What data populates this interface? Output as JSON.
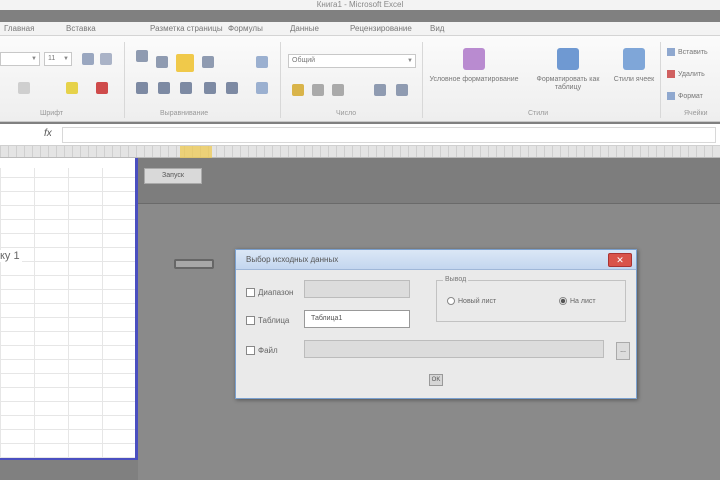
{
  "window": {
    "title": "Книга1 - Microsoft Excel"
  },
  "tabs": [
    {
      "label": "Главная"
    },
    {
      "label": "Вставка"
    },
    {
      "label": "Разметка страницы"
    },
    {
      "label": "Формулы"
    },
    {
      "label": "Данные"
    },
    {
      "label": "Рецензирование"
    },
    {
      "label": "Вид"
    }
  ],
  "ribbon": {
    "font_size_value": "11",
    "number_format_value": "Общий",
    "group_labels": {
      "font": "Шрифт",
      "alignment": "Выравнивание",
      "number": "Число",
      "styles": "Стили",
      "cells": "Ячейки"
    },
    "styles_buttons": [
      {
        "label": "Условное форматирование"
      },
      {
        "label": "Форматировать как таблицу"
      },
      {
        "label": "Стили ячеек"
      }
    ],
    "cells_items": [
      {
        "label": "Вставить"
      },
      {
        "label": "Удалить"
      },
      {
        "label": "Формат"
      }
    ]
  },
  "formula_bar": {
    "fx": "fx",
    "value": ""
  },
  "sheet": {
    "caption": "ку 1"
  },
  "editor": {
    "button_label": "Запуск"
  },
  "dialog": {
    "title": "Выбор исходных данных",
    "close_label": "✕",
    "options": [
      {
        "label": "Диапазон"
      },
      {
        "label": "Таблица"
      },
      {
        "label": "Файл"
      }
    ],
    "table_field_value": "Таблица1",
    "groupbox_label": "Вывод",
    "radios": [
      {
        "label": "Новый лист",
        "checked": false
      },
      {
        "label": "На лист",
        "checked": true
      }
    ],
    "browse_label": "...",
    "ok_label": "OK"
  },
  "colors": {
    "accent_border": "#4a4fc0",
    "dialog_title": "#c3d6ef",
    "close_button": "#d9534a"
  }
}
